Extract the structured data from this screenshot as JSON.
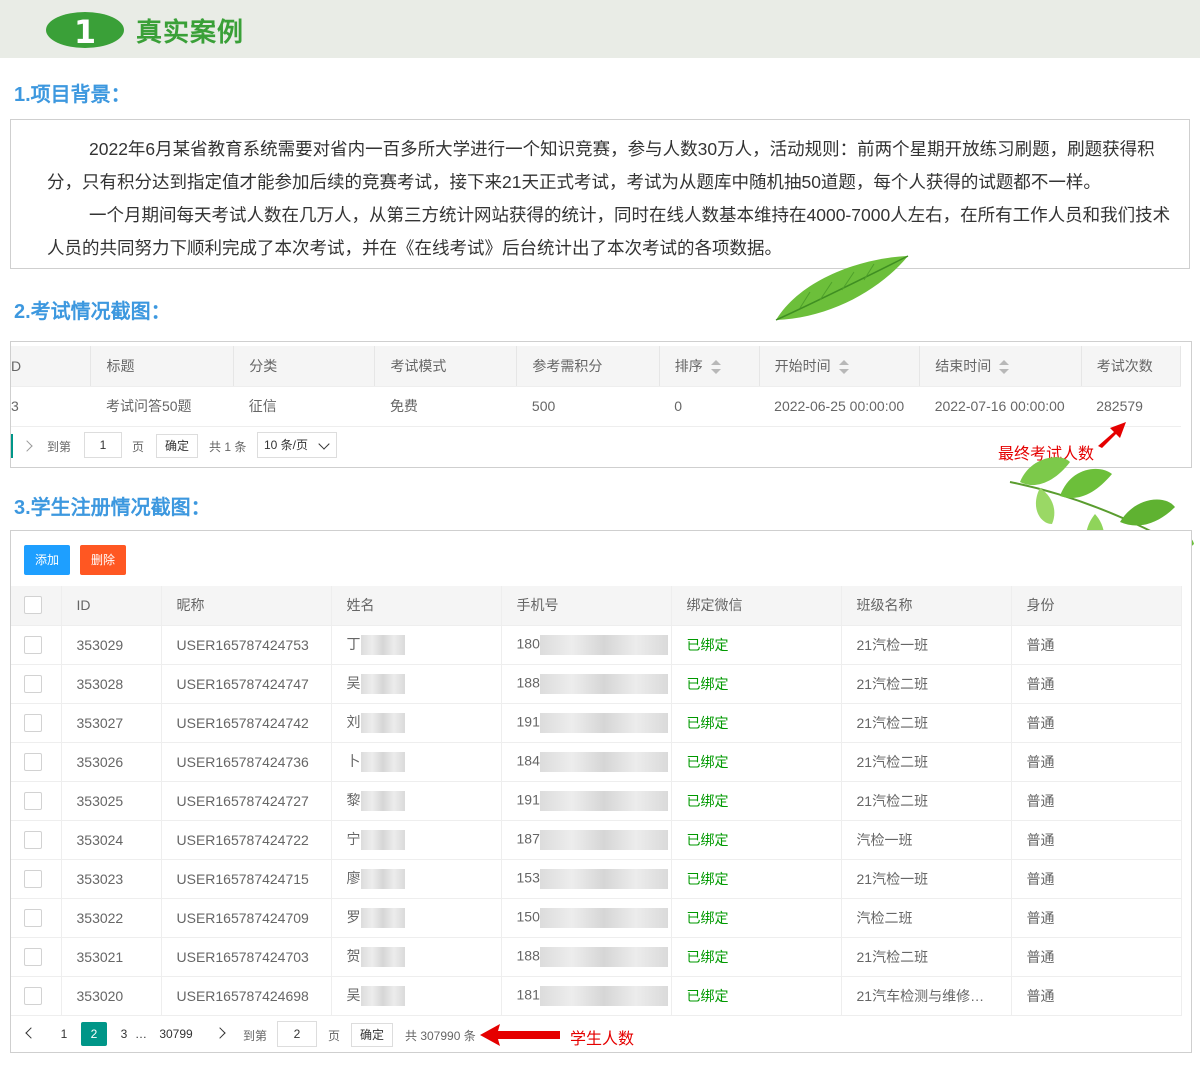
{
  "banner": {
    "number": "1",
    "title": "真实案例"
  },
  "section1": {
    "title": "1.项目背景："
  },
  "background": {
    "paragraph1": "2022年6月某省教育系统需要对省内一百多所大学进行一个知识竞赛，参与人数30万人，活动规则：前两个星期开放练习刷题，刷题获得积分，只有积分达到指定值才能参加后续的竞赛考试，接下来21天正式考试，考试为从题库中随机抽50道题，每个人获得的试题都不一样。",
    "paragraph2": "一个月期间每天考试人数在几万人，从第三方统计网站获得的统计，同时在线人数基本维持在4000-7000人左右，在所有工作人员和我们技术人员的共同努力下顺利完成了本次考试，并在《在线考试》后台统计出了本次考试的各项数据。"
  },
  "section2": {
    "title": "2.考试情况截图："
  },
  "exam_table": {
    "headers": [
      "D",
      "标题",
      "分类",
      "考试模式",
      "参考需积分",
      "排序",
      "开始时间",
      "结束时间",
      "考试次数"
    ],
    "row": [
      "3",
      "考试问答50题",
      "征信",
      "免费",
      "500",
      "0",
      "2022-06-25 00:00:00",
      "2022-07-16 00:00:00",
      "282579"
    ]
  },
  "exam_pager": {
    "goto_label": "到第",
    "page_value": "1",
    "page_unit": "页",
    "confirm_label": "确定",
    "total_text": "共 1 条",
    "page_size": "10 条/页"
  },
  "annotation_exam": "最终考试人数",
  "section3": {
    "title": "3.学生注册情况截图："
  },
  "student_toolbar": {
    "add_label": "添加",
    "delete_label": "删除"
  },
  "student_table": {
    "headers": [
      "ID",
      "昵称",
      "姓名",
      "手机号",
      "绑定微信",
      "班级名称",
      "身份"
    ],
    "rows": [
      {
        "id": "353029",
        "nickname": "USER165787424753",
        "name": "丁",
        "phone": "180",
        "wechat": "已绑定",
        "class": "21汽检一班",
        "role": "普通"
      },
      {
        "id": "353028",
        "nickname": "USER165787424747",
        "name": "吴",
        "phone": "188",
        "wechat": "已绑定",
        "class": "21汽检二班",
        "role": "普通"
      },
      {
        "id": "353027",
        "nickname": "USER165787424742",
        "name": "刘",
        "phone": "191",
        "wechat": "已绑定",
        "class": "21汽检二班",
        "role": "普通"
      },
      {
        "id": "353026",
        "nickname": "USER165787424736",
        "name": "卜",
        "phone": "184",
        "wechat": "已绑定",
        "class": "21汽检二班",
        "role": "普通"
      },
      {
        "id": "353025",
        "nickname": "USER165787424727",
        "name": "黎",
        "phone": "191",
        "wechat": "已绑定",
        "class": "21汽检二班",
        "role": "普通"
      },
      {
        "id": "353024",
        "nickname": "USER165787424722",
        "name": "宁",
        "phone": "187",
        "wechat": "已绑定",
        "class": "汽检一班",
        "role": "普通"
      },
      {
        "id": "353023",
        "nickname": "USER165787424715",
        "name": "廖",
        "phone": "153",
        "wechat": "已绑定",
        "class": "21汽检一班",
        "role": "普通"
      },
      {
        "id": "353022",
        "nickname": "USER165787424709",
        "name": "罗",
        "phone": "150",
        "wechat": "已绑定",
        "class": "汽检二班",
        "role": "普通"
      },
      {
        "id": "353021",
        "nickname": "USER165787424703",
        "name": "贺",
        "phone": "188",
        "wechat": "已绑定",
        "class": "21汽检二班",
        "role": "普通"
      },
      {
        "id": "353020",
        "nickname": "USER165787424698",
        "name": "吴",
        "phone": "181",
        "wechat": "已绑定",
        "class": "21汽车检测与维修…",
        "role": "普通"
      }
    ]
  },
  "student_pager": {
    "pages": [
      "1",
      "2",
      "3",
      "…",
      "30799"
    ],
    "active_page": "2",
    "goto_label": "到第",
    "page_value": "2",
    "page_unit": "页",
    "confirm_label": "确定",
    "total_text": "共 307990 条"
  },
  "annotation_students": "学生人数",
  "colors": {
    "accent_green": "#3aa038",
    "section_blue": "#3d98df",
    "add_button": "#1e9fff",
    "delete_button": "#ff5722",
    "active_page": "#009688",
    "annotation_red": "#e50000"
  }
}
